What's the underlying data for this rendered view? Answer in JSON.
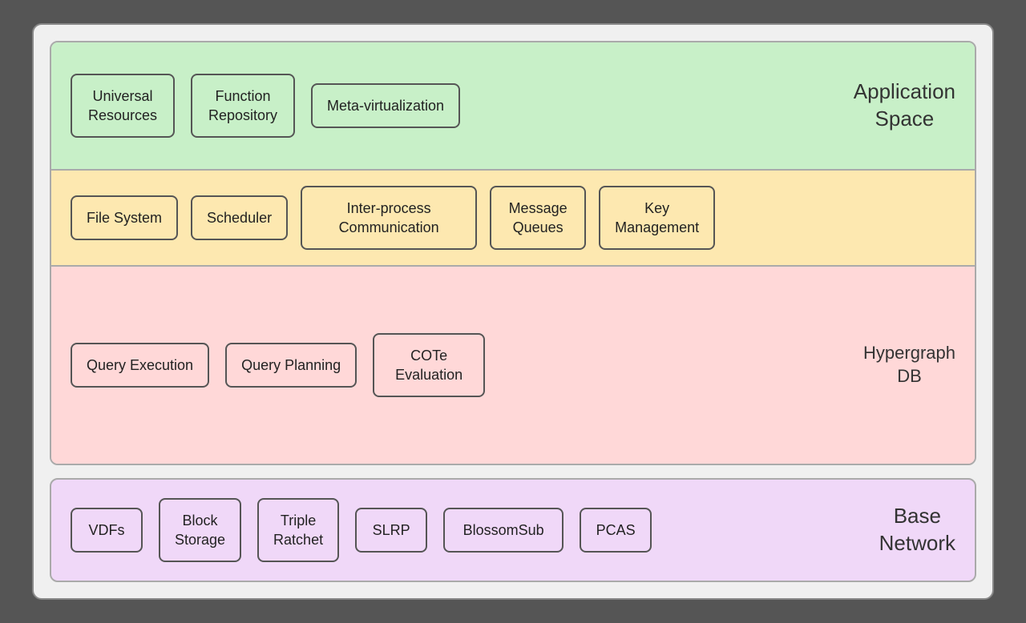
{
  "colors": {
    "app_space_bg": "#c8f0c8",
    "os_services_bg": "#fde8b0",
    "hypergraph_bg": "#ffd8d8",
    "base_network_bg": "#f0d8f8"
  },
  "app_space": {
    "label": "Application\nSpace",
    "boxes": [
      {
        "id": "universal-resources",
        "text": "Universal\nResources"
      },
      {
        "id": "function-repository",
        "text": "Function\nRepository"
      },
      {
        "id": "meta-virtualization",
        "text": "Meta-virtualization"
      }
    ]
  },
  "os_services": {
    "boxes": [
      {
        "id": "file-system",
        "text": "File System"
      },
      {
        "id": "scheduler",
        "text": "Scheduler"
      },
      {
        "id": "inter-process-communication",
        "text": "Inter-process\nCommunication",
        "wide": true
      },
      {
        "id": "message-queues",
        "text": "Message\nQueues"
      },
      {
        "id": "key-management",
        "text": "Key\nManagement"
      }
    ]
  },
  "hypergraph": {
    "label": "Hypergraph\nDB",
    "boxes": [
      {
        "id": "query-execution",
        "text": "Query Execution"
      },
      {
        "id": "query-planning",
        "text": "Query Planning"
      },
      {
        "id": "cote-evaluation",
        "text": "COTe\nEvaluation"
      }
    ]
  },
  "base_network": {
    "label": "Base\nNetwork",
    "boxes": [
      {
        "id": "vdfs",
        "text": "VDFs"
      },
      {
        "id": "block-storage",
        "text": "Block\nStorage"
      },
      {
        "id": "triple-ratchet",
        "text": "Triple\nRatchet"
      },
      {
        "id": "slrp",
        "text": "SLRP"
      },
      {
        "id": "blossomsub",
        "text": "BlossomSub"
      },
      {
        "id": "pcas",
        "text": "PCAS"
      }
    ]
  }
}
